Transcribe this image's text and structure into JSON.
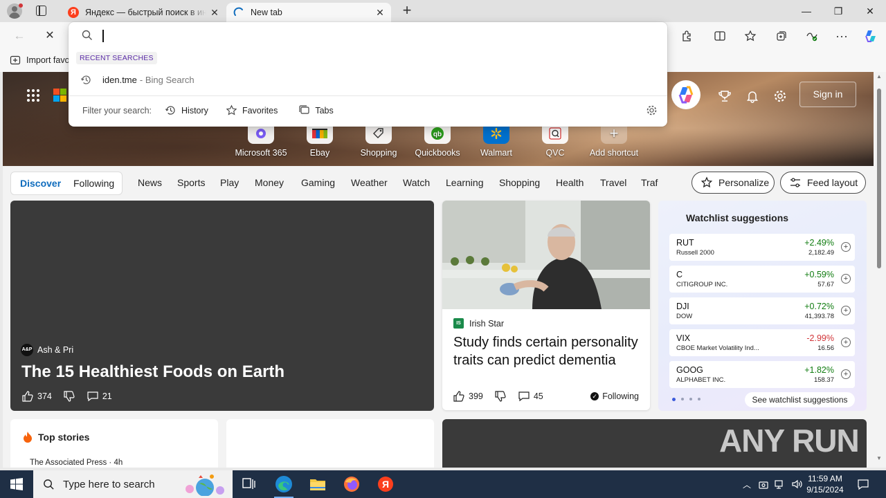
{
  "browser": {
    "tabs": [
      {
        "title": "Яндекс — быстрый поиск в интернете",
        "favicon": "yandex-icon"
      },
      {
        "title": "New tab",
        "favicon": "edge-loading-icon"
      }
    ],
    "favorites_bar": {
      "import_label": "Import favo"
    }
  },
  "omnibox": {
    "value": "",
    "recent_label": "RECENT SEARCHES",
    "recent_items": [
      {
        "query": "iden.tme",
        "suffix": "- Bing Search"
      }
    ],
    "filter_label": "Filter your search:",
    "filters": [
      "History",
      "Favorites",
      "Tabs"
    ]
  },
  "newtab": {
    "signin_label": "Sign in",
    "shortcuts": [
      "Microsoft 365",
      "Ebay",
      "Shopping",
      "Quickbooks",
      "Walmart",
      "QVC",
      "Add shortcut"
    ],
    "feed": {
      "discover_label": "Discover",
      "following_label": "Following",
      "categories": [
        "News",
        "Sports",
        "Play",
        "Money",
        "Gaming",
        "Weather",
        "Watch",
        "Learning",
        "Shopping",
        "Health",
        "Travel",
        "Traf"
      ],
      "personalize_label": "Personalize",
      "feed_layout_label": "Feed layout"
    },
    "main_story": {
      "source": "Ash & Pri",
      "source_logo": "A&P",
      "title": "The 15 Healthiest Foods on Earth",
      "likes": "374",
      "comments": "21"
    },
    "second_story": {
      "source": "Irish Star",
      "title": "Study finds certain personality traits can predict dementia",
      "likes": "399",
      "comments": "45",
      "following_label": "Following"
    },
    "watchlist": {
      "title": "Watchlist suggestions",
      "items": [
        {
          "symbol": "RUT",
          "name": "Russell 2000",
          "change": "+2.49%",
          "price": "2,182.49",
          "direction": "up"
        },
        {
          "symbol": "C",
          "name": "CITIGROUP INC.",
          "change": "+0.59%",
          "price": "57.67",
          "direction": "up"
        },
        {
          "symbol": "DJI",
          "name": "DOW",
          "change": "+0.72%",
          "price": "41,393.78",
          "direction": "up"
        },
        {
          "symbol": "VIX",
          "name": "CBOE Market Volatility Ind...",
          "change": "-2.99%",
          "price": "16.56",
          "direction": "down"
        },
        {
          "symbol": "GOOG",
          "name": "ALPHABET INC.",
          "change": "+1.82%",
          "price": "158.37",
          "direction": "up"
        }
      ],
      "see_more_label": "See watchlist suggestions"
    },
    "top_stories": {
      "title": "Top stories",
      "source": "The Associated Press · 4h"
    },
    "watermark": "ANY RUN"
  },
  "taskbar": {
    "search_placeholder": "Type here to search",
    "time": "11:59 AM",
    "date": "9/15/2024"
  },
  "colors": {
    "accent": "#0f6cbd",
    "positive": "#107c10",
    "negative": "#d13438",
    "recent_label": "#5a2ba6",
    "taskbar": "#1f2f45"
  }
}
